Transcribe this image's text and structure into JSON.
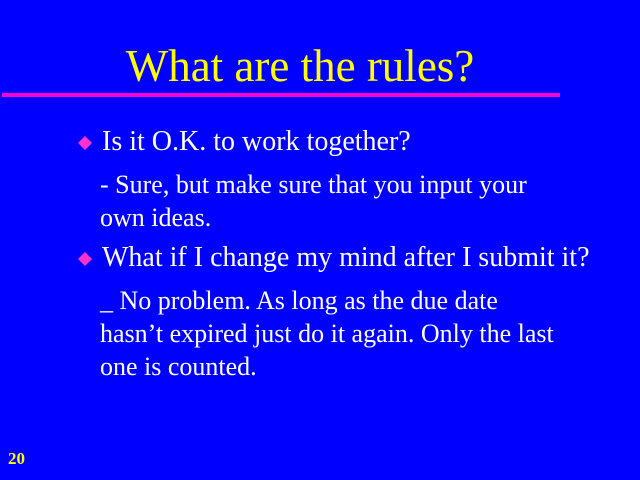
{
  "slide": {
    "title": "What are the rules?",
    "page_number": "20",
    "items": [
      {
        "question": "Is it O.K. to work together?",
        "answer_lines": [
          "- Sure, but make sure that you input your",
          "own ideas."
        ]
      },
      {
        "question": "What if I change my mind after I submit it?",
        "answer_lines": [
          "_ No problem. As long as the due date",
          "hasn’t expired just do it again. Only the last",
          "one is counted."
        ]
      }
    ]
  },
  "colors": {
    "background": "#0000ff",
    "title": "#ffff00",
    "rule": "#ff00cc",
    "bullet": "#ff33cc",
    "text": "#ffffff",
    "page_number": "#ffff00"
  },
  "icons": {
    "bullet": "diamond-bullet-icon"
  }
}
